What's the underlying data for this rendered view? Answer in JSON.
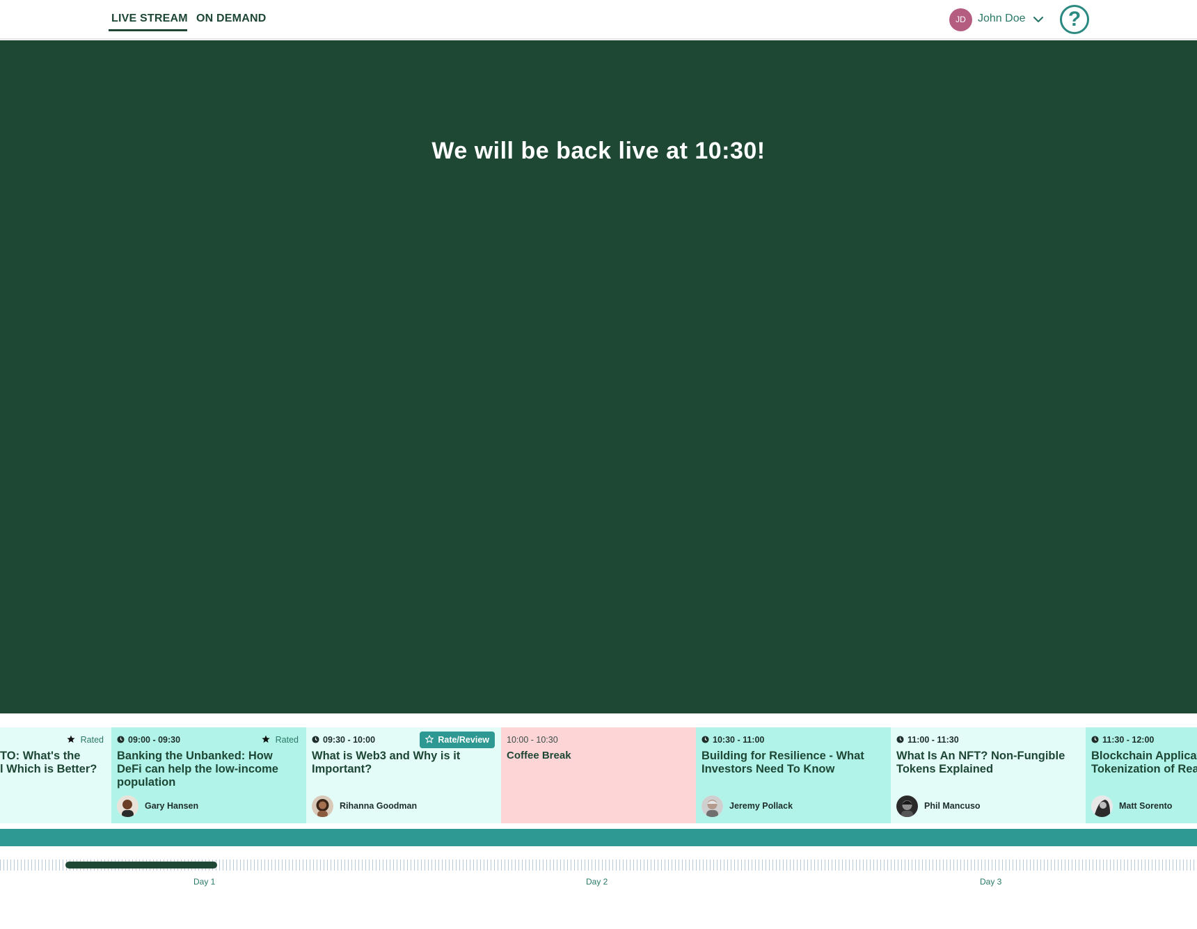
{
  "nav": {
    "tabs": [
      {
        "label": "LIVE STREAM",
        "active": true
      },
      {
        "label": "ON DEMAND",
        "active": false
      }
    ]
  },
  "user": {
    "initials": "JD",
    "name": "John Doe",
    "avatar_color": "#b45d80"
  },
  "help": {
    "icon": "?"
  },
  "stage": {
    "message": "We will be back live at 10:30!",
    "background": "#1e4834"
  },
  "schedule": [
    {
      "time": "",
      "title": "TO: What's the\nl Which is Better?",
      "speaker": "",
      "status": "Rated"
    },
    {
      "time": "09:00 - 09:30",
      "title": "Banking the Unbanked: How DeFi can help the low-income population",
      "speaker": "Gary Hansen",
      "status": "Rated"
    },
    {
      "time": "09:30 - 10:00",
      "title": "What is Web3 and Why is it Important?",
      "speaker": "Rihanna Goodman",
      "status": "Rate/Review"
    },
    {
      "time": "10:00 - 10:30",
      "title": "Coffee Break",
      "speaker": "",
      "status": ""
    },
    {
      "time": "10:30 - 11:00",
      "title": "Building for Resilience - What Investors Need To Know",
      "speaker": "Jeremy Pollack",
      "status": ""
    },
    {
      "time": "11:00 - 11:30",
      "title": "What Is An NFT? Non-Fungible Tokens Explained",
      "speaker": "Phil Mancuso",
      "status": ""
    },
    {
      "time": "11:30 - 12:00",
      "title": "Blockchain Applicat\nTokenization of Rea",
      "speaker": "Matt Sorento",
      "status": ""
    }
  ],
  "timeline": {
    "days": [
      "Day 1",
      "Day 2",
      "Day 3"
    ],
    "thumb_position_fraction": 0.118
  },
  "colors": {
    "primary_dark": "#1e4834",
    "teal": "#2e9893",
    "card_light": "#e3fcf8",
    "card_mid": "#b2f3e9",
    "break_pink": "#fdd5d6"
  }
}
